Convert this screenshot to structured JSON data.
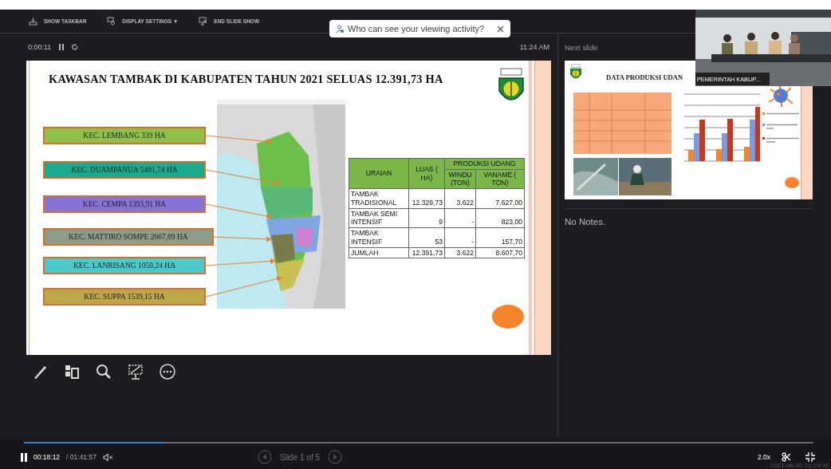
{
  "toolbar": [
    {
      "kind": "taskbar",
      "label": "SHOW TASKBAR"
    },
    {
      "kind": "display",
      "label": "DISPLAY SETTINGS ▼"
    },
    {
      "kind": "end",
      "label": "END SLIDE SHOW"
    }
  ],
  "popup": {
    "text": "Who can see your viewing activity?"
  },
  "timer": {
    "elapsed": "0:00:11",
    "clock": "11:24 AM"
  },
  "slide": {
    "title": "KAWASAN TAMBAK DI KABUPATEN TAHUN 2021 SELUAS 12.391,73 HA",
    "labels": [
      {
        "text": "KEC. LEMBANG 339 HA",
        "color": "#8fc04a"
      },
      {
        "text": "KEC. DUAMPANUA 5401,74 HA",
        "color": "#1aab8f"
      },
      {
        "text": "KEC. CEMPA 1393,91 HA",
        "color": "#8474d8"
      },
      {
        "text": "KEC. MATTIRO SOMPE 2667,69 HA",
        "color": "#8e9c8a"
      },
      {
        "text": "KEC. LANRISANG 1050,24 HA",
        "color": "#4ccaca"
      },
      {
        "text": "KEC. SUPPA 1539,15 HA",
        "color": "#bca84a"
      }
    ],
    "table": {
      "head": {
        "item": "URAIAN",
        "area": "LUAS ( HA)",
        "group": "PRODUKSI UDANG",
        "windu": "WINDU (TON)",
        "vaname": "VANAME ( TON)"
      },
      "rows": [
        [
          "TAMBAK TRADISIONAL",
          "12.329,73",
          "3.622",
          "7.627,00"
        ],
        [
          "TAMBAK SEMI INTENSIF",
          "9",
          "-",
          "823,00"
        ],
        [
          "TAMBAK INTENSIF",
          "53",
          "-",
          "157,70"
        ],
        [
          "JUMLAH",
          "12.391,73",
          "3.622",
          "8.607,70"
        ]
      ]
    }
  },
  "tools": [
    {
      "kind": "pen"
    },
    {
      "kind": "layout"
    },
    {
      "kind": "zoom"
    },
    {
      "kind": "screen"
    },
    {
      "kind": "more"
    }
  ],
  "next_slide": {
    "heading": "Next slide",
    "title": "DATA PRODUKSI UDAN"
  },
  "notes": "No Notes.",
  "video": {
    "caption": "PEMERINTAH KABUP..."
  },
  "player": {
    "position": "00:18:12",
    "duration": "/ 01:41:57",
    "level": 0.18,
    "slide_counter": "Slide 1 of 5",
    "speed": "2.0x",
    "timestamp": "2021-08-30 10:24:41"
  }
}
